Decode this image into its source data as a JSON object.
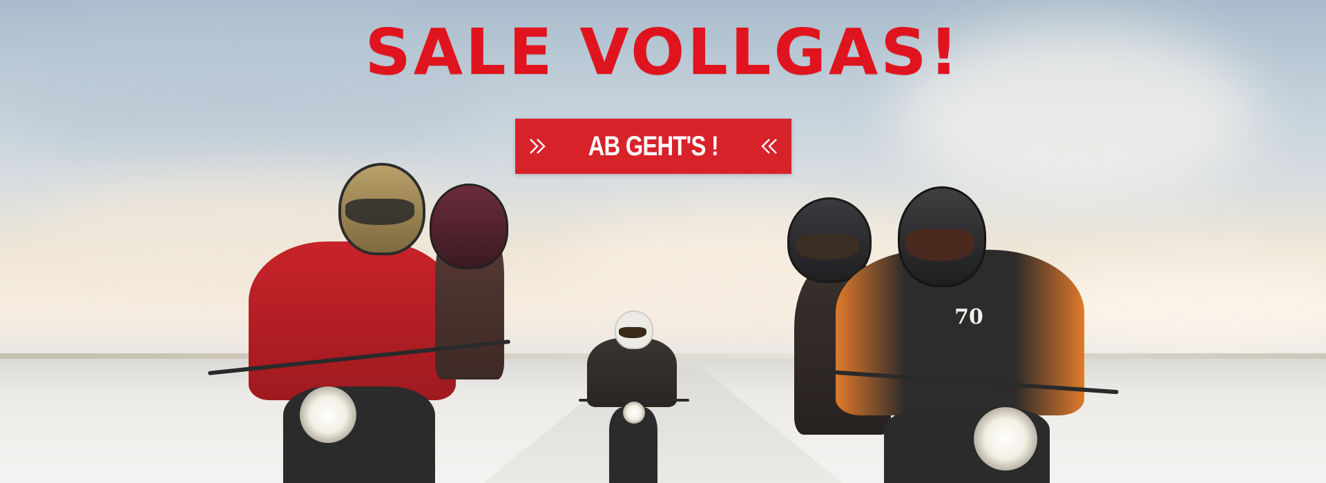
{
  "banner": {
    "headline": "SALE VOLLGAS!",
    "cta_label": "AB GEHT'S !",
    "cta_left_icon": "chevron-double-right-icon",
    "cta_right_icon": "chevron-double-left-icon",
    "jacket_number": "70",
    "colors": {
      "headline": "#e0141f",
      "cta_background": "#d8222a",
      "cta_text": "#ffffff"
    }
  }
}
